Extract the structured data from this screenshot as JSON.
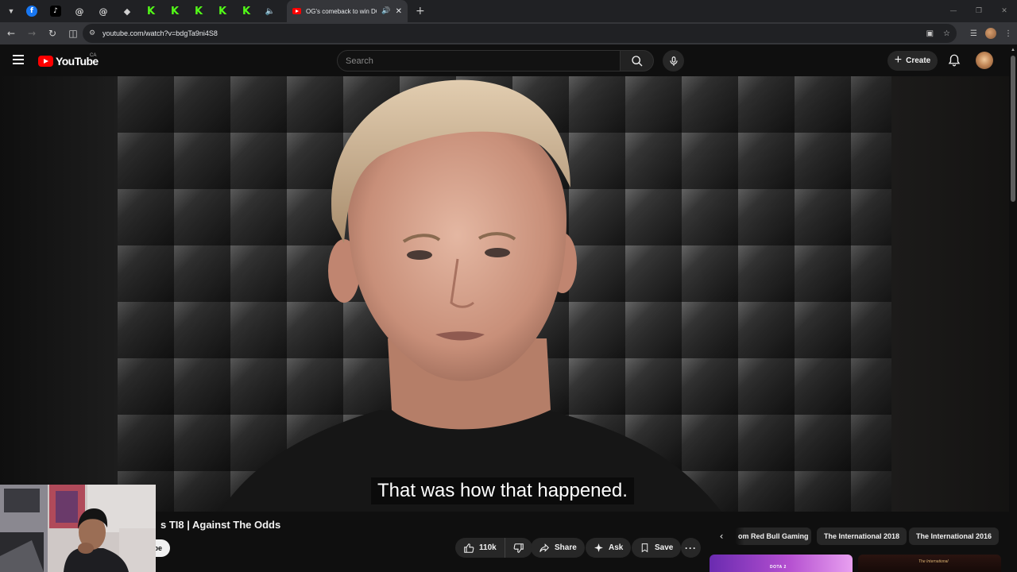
{
  "browser": {
    "active_tab_title": "OG's comeback to win DOTA",
    "url": "youtube.com/watch?v=bdgTa9ni4S8",
    "pinned_tabs": [
      "facebook-icon",
      "tiktok-icon",
      "threads-icon",
      "threads-icon",
      "diamond-icon",
      "kick-icon",
      "kick-icon",
      "kick-icon",
      "kick-icon",
      "kick-icon"
    ]
  },
  "masthead": {
    "logo_text": "YouTube",
    "country_code": "CA",
    "search_placeholder": "Search",
    "create_label": "Create"
  },
  "video": {
    "subtitle": "That was how that happened.",
    "title_visible": "s TI8 | Against The Odds",
    "subscribe_partial": "be"
  },
  "actions": {
    "like_count": "110k",
    "share_label": "Share",
    "ask_label": "Ask",
    "save_label": "Save"
  },
  "chips": [
    "om Red Bull Gaming",
    "The International 2018",
    "The International 2016"
  ],
  "thumbnails": {
    "first_text": "DOTA 2",
    "second_text": "The International"
  },
  "colors": {
    "brand_red": "#ff0000",
    "background": "#0f0f0f",
    "pill": "#272727",
    "kick_green": "#53fc18"
  }
}
